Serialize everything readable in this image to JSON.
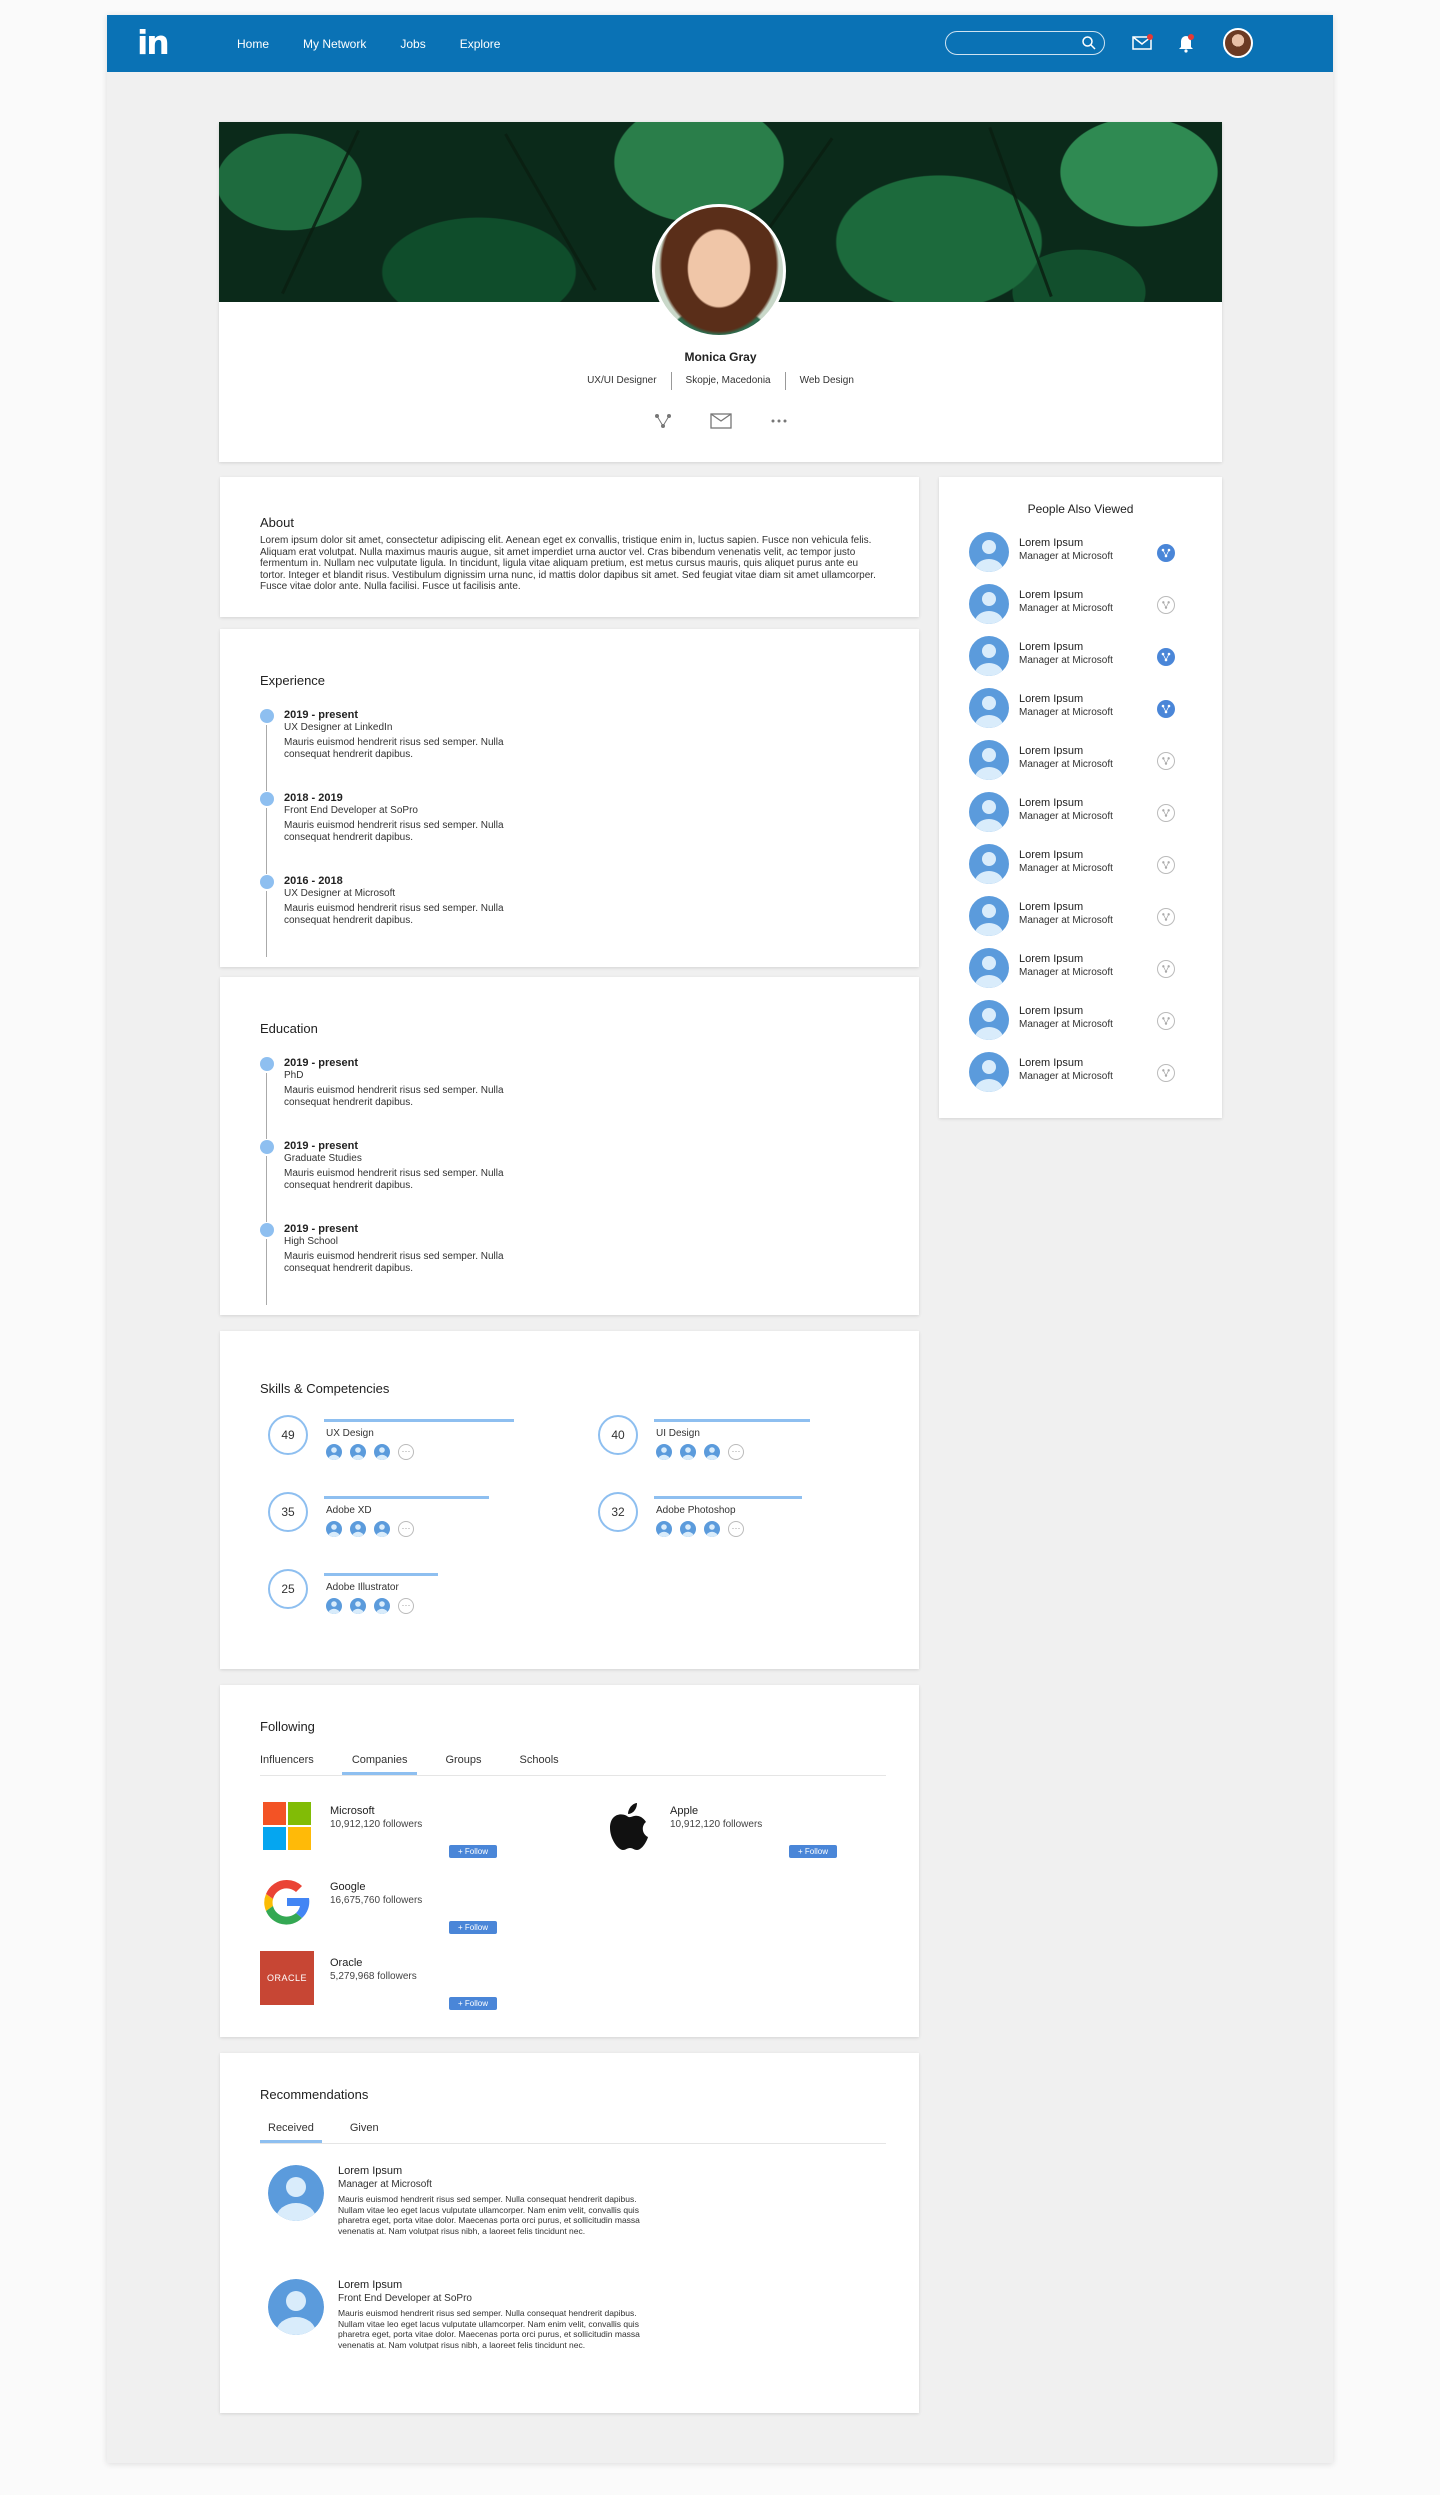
{
  "nav": {
    "logo": "in",
    "links": [
      "Home",
      "My Network",
      "Jobs",
      "Explore"
    ],
    "search_value": "",
    "notification_color": "#e53935"
  },
  "profile": {
    "name": "Monica Gray",
    "meta": [
      "UX/UI Designer",
      "Skopje, Macedonia",
      "Web Design"
    ]
  },
  "about": {
    "title": "About",
    "text": "Lorem ipsum dolor sit amet, consectetur adipiscing elit. Aenean eget ex convallis, tristique enim in, luctus sapien. Fusce non vehicula felis. Aliquam erat volutpat. Nulla maximus mauris augue, sit amet imperdiet urna auctor vel. Cras bibendum venenatis velit, ac tempor justo fermentum in. Nullam nec vulputate ligula. In tincidunt, ligula vitae aliquam pretium, est metus cursus mauris, quis aliquet purus ante eu tortor. Integer et blandit risus. Vestibulum dignissim urna nunc, id mattis dolor dapibus sit amet. Sed feugiat vitae diam sit amet ullamcorper. Fusce vitae dolor ante. Nulla facilisi. Fusce ut facilisis ante."
  },
  "experience": {
    "title": "Experience",
    "items": [
      {
        "period": "2019 - present",
        "role": "UX Designer at LinkedIn",
        "desc": "Mauris euismod hendrerit risus sed semper. Nulla consequat hendrerit dapibus."
      },
      {
        "period": "2018 - 2019",
        "role": "Front End Developer at SoPro",
        "desc": "Mauris euismod hendrerit risus sed semper. Nulla consequat hendrerit dapibus."
      },
      {
        "period": "2016 - 2018",
        "role": "UX Designer at Microsoft",
        "desc": "Mauris euismod hendrerit risus sed semper. Nulla consequat hendrerit dapibus."
      }
    ]
  },
  "education": {
    "title": "Education",
    "items": [
      {
        "period": "2019 - present",
        "role": "PhD",
        "desc": "Mauris euismod hendrerit risus sed semper. Nulla consequat hendrerit dapibus."
      },
      {
        "period": "2019 - present",
        "role": "Graduate Studies",
        "desc": "Mauris euismod hendrerit risus sed semper. Nulla consequat hendrerit dapibus."
      },
      {
        "period": "2019 - present",
        "role": "High School",
        "desc": "Mauris euismod hendrerit risus sed semper. Nulla consequat hendrerit dapibus."
      }
    ]
  },
  "skills": {
    "title": "Skills & Competencies",
    "more": "···",
    "items": [
      {
        "count": "49",
        "name": "UX Design",
        "level": 1.0
      },
      {
        "count": "40",
        "name": "UI Design",
        "level": 0.82
      },
      {
        "count": "35",
        "name": "Adobe XD",
        "level": 0.87
      },
      {
        "count": "32",
        "name": "Adobe Photoshop",
        "level": 0.78
      },
      {
        "count": "25",
        "name": "Adobe Illustrator",
        "level": 0.6
      }
    ]
  },
  "following": {
    "title": "Following",
    "tabs": [
      "Influencers",
      "Companies",
      "Groups",
      "Schools"
    ],
    "active_tab": 1,
    "follow_label": "+ Follow",
    "companies": [
      {
        "name": "Microsoft",
        "followers": "10,912,120 followers",
        "logo": "microsoft-logo"
      },
      {
        "name": "Apple",
        "followers": "10,912,120 followers",
        "logo": "apple-logo"
      },
      {
        "name": "Google",
        "followers": "16,675,760 followers",
        "logo": "google-logo"
      },
      {
        "name": "Oracle",
        "followers": "5,279,968 followers",
        "logo": "oracle-logo",
        "logo_text": "ORACLE"
      }
    ]
  },
  "recommendations": {
    "title": "Recommendations",
    "tabs": [
      "Received",
      "Given"
    ],
    "active_tab": 0,
    "items": [
      {
        "name": "Lorem Ipsum",
        "role": "Manager at Microsoft",
        "text": "Mauris euismod hendrerit risus sed semper. Nulla consequat hendrerit dapibus. Nullam vitae leo eget lacus vulputate ullamcorper. Nam enim velit, convallis quis pharetra eget, porta vitae dolor. Maecenas porta orci purus, et sollicitudin massa venenatis at. Nam volutpat risus nibh, a laoreet felis tincidunt nec."
      },
      {
        "name": "Lorem Ipsum",
        "role": "Front End Developer at SoPro",
        "text": "Mauris euismod hendrerit risus sed semper. Nulla consequat hendrerit dapibus. Nullam vitae leo eget lacus vulputate ullamcorper. Nam enim velit, convallis quis pharetra eget, porta vitae dolor. Maecenas porta orci purus, et sollicitudin massa venenatis at. Nam volutpat risus nibh, a laoreet felis tincidunt nec."
      }
    ]
  },
  "people": {
    "title": "People Also Viewed",
    "items": [
      {
        "name": "Lorem Ipsum",
        "role": "Manager at Microsoft",
        "connected": true
      },
      {
        "name": "Lorem Ipsum",
        "role": "Manager at Microsoft",
        "connected": false
      },
      {
        "name": "Lorem Ipsum",
        "role": "Manager at Microsoft",
        "connected": true
      },
      {
        "name": "Lorem Ipsum",
        "role": "Manager at Microsoft",
        "connected": true
      },
      {
        "name": "Lorem Ipsum",
        "role": "Manager at Microsoft",
        "connected": false
      },
      {
        "name": "Lorem Ipsum",
        "role": "Manager at Microsoft",
        "connected": false
      },
      {
        "name": "Lorem Ipsum",
        "role": "Manager at Microsoft",
        "connected": false
      },
      {
        "name": "Lorem Ipsum",
        "role": "Manager at Microsoft",
        "connected": false
      },
      {
        "name": "Lorem Ipsum",
        "role": "Manager at Microsoft",
        "connected": false
      },
      {
        "name": "Lorem Ipsum",
        "role": "Manager at Microsoft",
        "connected": false
      },
      {
        "name": "Lorem Ipsum",
        "role": "Manager at Microsoft",
        "connected": false
      }
    ]
  },
  "colors": {
    "nav": "#0a72b5",
    "accent": "#8ebff0",
    "button": "#4a86d8"
  }
}
